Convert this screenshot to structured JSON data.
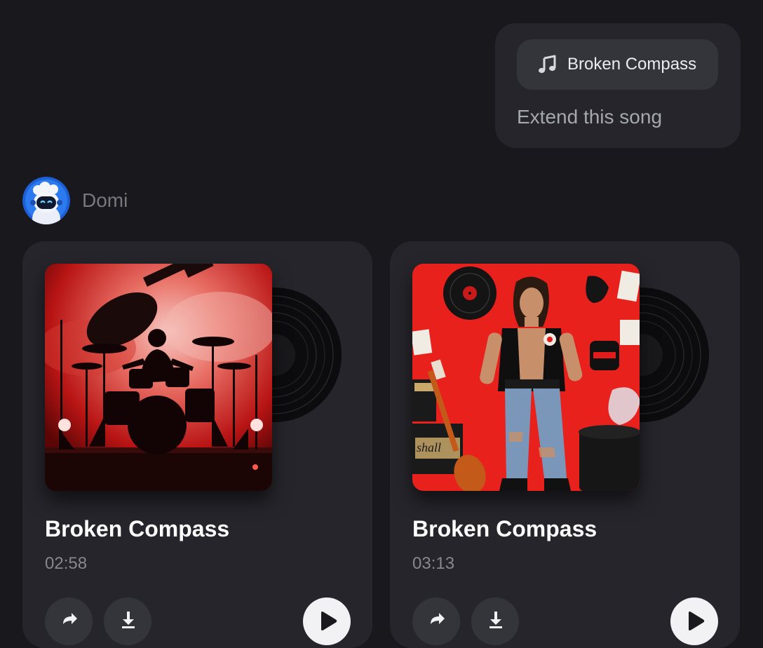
{
  "user_message": {
    "song_chip": {
      "icon": "music-note-icon",
      "label": "Broken Compass"
    },
    "text": "Extend this song"
  },
  "assistant": {
    "name": "Domi",
    "avatar_icon": "robot-avatar"
  },
  "songs": [
    {
      "title": "Broken Compass",
      "duration": "02:58",
      "cover": "drummer-silhouette-red-smoke-art"
    },
    {
      "title": "Broken Compass",
      "duration": "03:13",
      "cover": "punk-rocker-red-collage-art"
    }
  ],
  "colors": {
    "background": "#18181d",
    "card": "#25252b",
    "chip": "#34343b",
    "accent_red": "#e31b1b"
  }
}
